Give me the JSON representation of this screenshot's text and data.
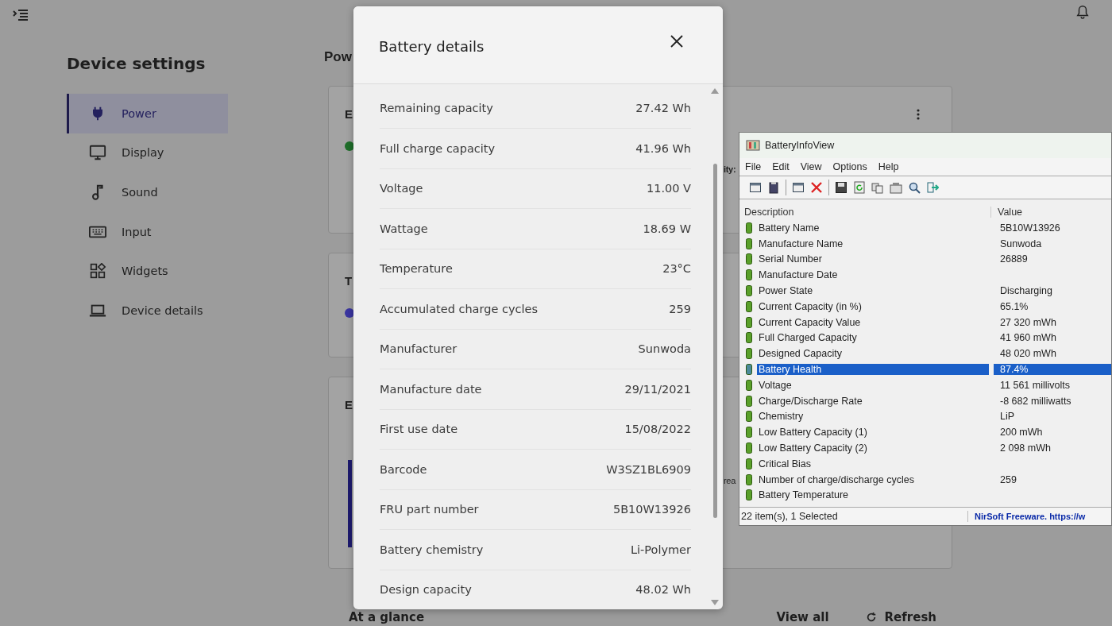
{
  "sidebar": {
    "title": "Device settings",
    "items": [
      {
        "label": "Power",
        "selected": true
      },
      {
        "label": "Display",
        "selected": false
      },
      {
        "label": "Sound",
        "selected": false
      },
      {
        "label": "Input",
        "selected": false
      },
      {
        "label": "Widgets",
        "selected": false
      },
      {
        "label": "Device details",
        "selected": false
      }
    ]
  },
  "main": {
    "heading": "Pow",
    "cards": [
      {
        "title": "E",
        "side_text": "ity:"
      },
      {
        "title": "T"
      },
      {
        "title": "E",
        "side_text": "rea"
      }
    ],
    "glance": {
      "title": "At a glance",
      "view_all": "View all",
      "refresh": "Refresh"
    }
  },
  "battery_dialog": {
    "title": "Battery details",
    "rows": [
      {
        "label": "Remaining capacity",
        "value": "27.42 Wh"
      },
      {
        "label": "Full charge capacity",
        "value": "41.96 Wh"
      },
      {
        "label": "Voltage",
        "value": "11.00 V"
      },
      {
        "label": "Wattage",
        "value": "18.69 W"
      },
      {
        "label": "Temperature",
        "value": "23°C"
      },
      {
        "label": "Accumulated charge cycles",
        "value": "259"
      },
      {
        "label": "Manufacturer",
        "value": "Sunwoda"
      },
      {
        "label": "Manufacture date",
        "value": "29/11/2021"
      },
      {
        "label": "First use date",
        "value": "15/08/2022"
      },
      {
        "label": "Barcode",
        "value": "W3SZ1BL6909"
      },
      {
        "label": "FRU part number",
        "value": "5B10W13926"
      },
      {
        "label": "Battery chemistry",
        "value": "Li-Polymer"
      },
      {
        "label": "Design capacity",
        "value": "48.02 Wh"
      }
    ]
  },
  "info_window": {
    "title": "BatteryInfoView",
    "menu": [
      "File",
      "Edit",
      "View",
      "Options",
      "Help"
    ],
    "columns": [
      "Description",
      "Value"
    ],
    "rows": [
      {
        "description": "Battery Name",
        "value": "5B10W13926",
        "selected": false
      },
      {
        "description": "Manufacture Name",
        "value": "Sunwoda",
        "selected": false
      },
      {
        "description": "Serial Number",
        "value": "26889",
        "selected": false
      },
      {
        "description": "Manufacture Date",
        "selected": false
      },
      {
        "description": "Power State",
        "value": "Discharging",
        "selected": false
      },
      {
        "description": "Current Capacity (in %)",
        "value": "65.1%",
        "selected": false
      },
      {
        "description": "Current Capacity Value",
        "value": "27 320 mWh",
        "selected": false
      },
      {
        "description": "Full Charged Capacity",
        "value": "41 960 mWh",
        "selected": false
      },
      {
        "description": "Designed Capacity",
        "value": "48 020 mWh",
        "selected": false
      },
      {
        "description": "Battery Health",
        "value": "87.4%",
        "selected": true
      },
      {
        "description": "Voltage",
        "value": "11 561 millivolts",
        "selected": false
      },
      {
        "description": "Charge/Discharge Rate",
        "value": "-8 682 milliwatts",
        "selected": false
      },
      {
        "description": "Chemistry",
        "value": "LiP",
        "selected": false
      },
      {
        "description": "Low Battery Capacity (1)",
        "value": "200 mWh",
        "selected": false
      },
      {
        "description": "Low Battery Capacity (2)",
        "value": "2 098 mWh",
        "selected": false
      },
      {
        "description": "Critical Bias",
        "selected": false
      },
      {
        "description": "Number of charge/discharge cycles",
        "value": "259",
        "selected": false
      },
      {
        "description": "Battery Temperature",
        "selected": false
      }
    ],
    "status": "22 item(s), 1 Selected",
    "credit": "NirSoft Freeware. https://w"
  }
}
